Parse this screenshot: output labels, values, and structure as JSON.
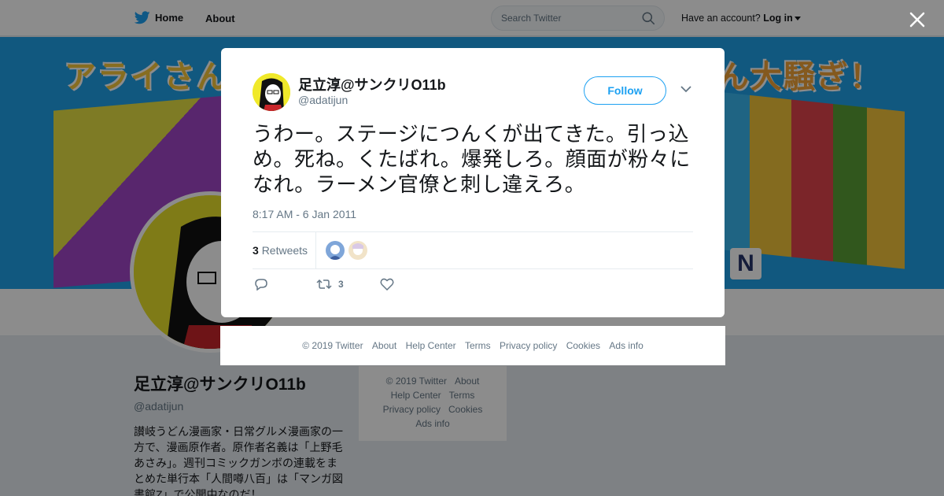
{
  "nav": {
    "home": "Home",
    "about": "About"
  },
  "search": {
    "placeholder": "Search Twitter"
  },
  "account": {
    "prompt": "Have an account?",
    "login": "Log in"
  },
  "banner": {
    "left_heading": "アライさん",
    "right_heading": "ん大騒ぎ！",
    "badge": "N"
  },
  "profile": {
    "name": "足立淳@サンクリO11b",
    "handle": "@adatijun",
    "bio": "讃岐うどん漫画家・日常グルメ漫画家の一方で、漫画原作者。原作者名義は「上野毛あさみ」。週刊コミックガンボの連載をまとめた単行本「人間噂八百」は「マンガ図書館Z」で公開中なのだ！"
  },
  "side_footer": {
    "items": [
      "© 2019 Twitter",
      "About",
      "Help Center",
      "Terms",
      "Privacy policy",
      "Cookies",
      "Ads info"
    ]
  },
  "tweet": {
    "author_name": "足立淳@サンクリO11b",
    "author_handle": "@adatijun",
    "follow_label": "Follow",
    "text": "うわー。ステージにつんくが出てきた。引っ込め。死ね。くたばれ。爆発しろ。顔面が粉々になれ。ラーメン官僚と刺し違えろ。",
    "timestamp": "8:17 AM - 6 Jan 2011",
    "retweet_count": "3",
    "retweet_label": "Retweets",
    "action_retweet_count": "3"
  },
  "footer": {
    "copyright": "© 2019 Twitter",
    "about": "About",
    "help": "Help Center",
    "terms": "Terms",
    "privacy": "Privacy policy",
    "cookies": "Cookies",
    "ads": "Ads info"
  },
  "colors": {
    "brand": "#1da1f2",
    "text": "#14171a",
    "muted": "#657786"
  },
  "icons": [
    "twitter-bird-icon",
    "search-icon",
    "close-icon",
    "chevron-down-icon",
    "reply-icon",
    "retweet-icon",
    "like-icon"
  ]
}
